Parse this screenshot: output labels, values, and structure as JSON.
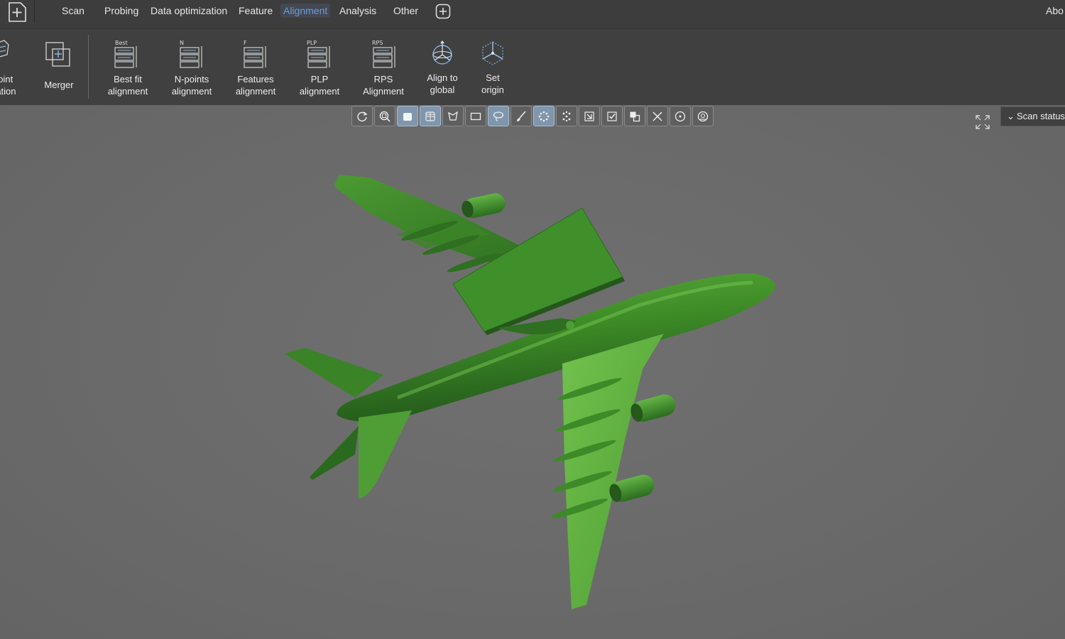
{
  "menu": {
    "items": [
      "Scan",
      "Probing",
      "Data optimization",
      "Feature",
      "Alignment",
      "Analysis",
      "Other"
    ],
    "active": "Alignment",
    "about_label": "Abo"
  },
  "ribbon": {
    "tools": [
      {
        "line1": "point",
        "line2": "ration",
        "icon": "point-registration-icon"
      },
      {
        "line1": "Merger",
        "line2": "",
        "icon": "merger-icon"
      },
      {
        "line1": "Best fit",
        "line2": "alignment",
        "badge": "Best",
        "icon": "best-fit-alignment-icon"
      },
      {
        "line1": "N-points",
        "line2": "alignment",
        "badge": "N",
        "icon": "n-points-alignment-icon"
      },
      {
        "line1": "Features",
        "line2": "alignment",
        "badge": "F",
        "icon": "features-alignment-icon"
      },
      {
        "line1": "PLP",
        "line2": "alignment",
        "badge": "PLP",
        "icon": "plp-alignment-icon"
      },
      {
        "line1": "RPS",
        "line2": "Alignment",
        "badge": "RPS",
        "icon": "rps-alignment-icon"
      },
      {
        "line1": "Align to",
        "line2": "global",
        "icon": "align-to-global-icon"
      },
      {
        "line1": "Set",
        "line2": "origin",
        "icon": "set-origin-icon"
      }
    ]
  },
  "view_toolbar": {
    "buttons": [
      "rotate-icon",
      "zoom-fit-icon",
      "solid-shading-icon",
      "wireframe-icon",
      "polygon-select-icon",
      "rectangle-select-icon",
      "lasso-select-icon",
      "brush-select-icon",
      "point-select-icon",
      "grid-points-icon",
      "select-through-icon",
      "confirm-icon",
      "clone-icon",
      "delete-icon",
      "center-icon",
      "target-icon"
    ],
    "active": [
      "solid-shading-icon",
      "wireframe-icon",
      "lasso-select-icon",
      "point-select-icon"
    ]
  },
  "scan_status": {
    "label": "Scan status"
  },
  "colors": {
    "accent": "#6f9bd6",
    "model": "#3f8f2b",
    "background": "#6b6b6b"
  }
}
